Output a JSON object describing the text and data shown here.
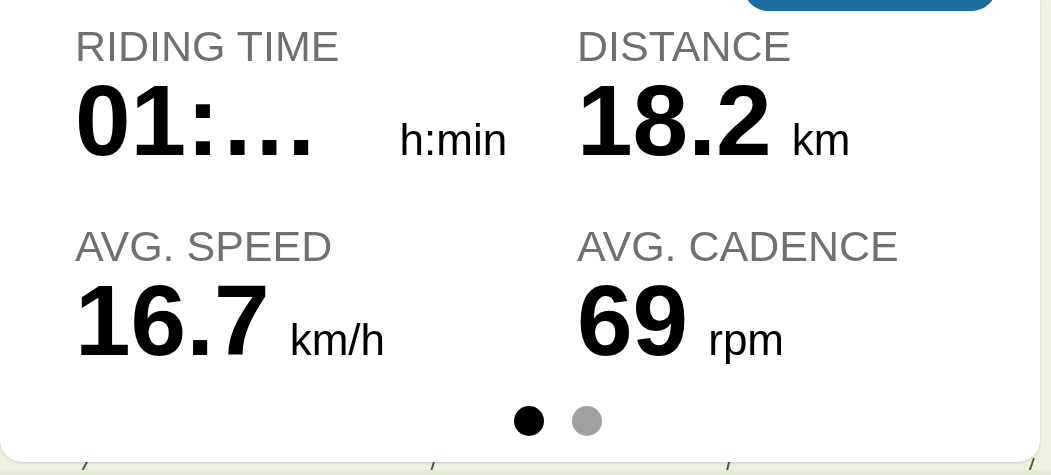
{
  "stats": [
    {
      "label": "RIDING TIME",
      "value": "01:…",
      "unit": "h:min"
    },
    {
      "label": "DISTANCE",
      "value": "18.2",
      "unit": "km"
    },
    {
      "label": "AVG. SPEED",
      "value": "16.7",
      "unit": "km/h"
    },
    {
      "label": "AVG. CADENCE",
      "value": "69",
      "unit": "rpm"
    }
  ],
  "pages": [
    {
      "selected": true
    },
    {
      "selected": false
    }
  ]
}
